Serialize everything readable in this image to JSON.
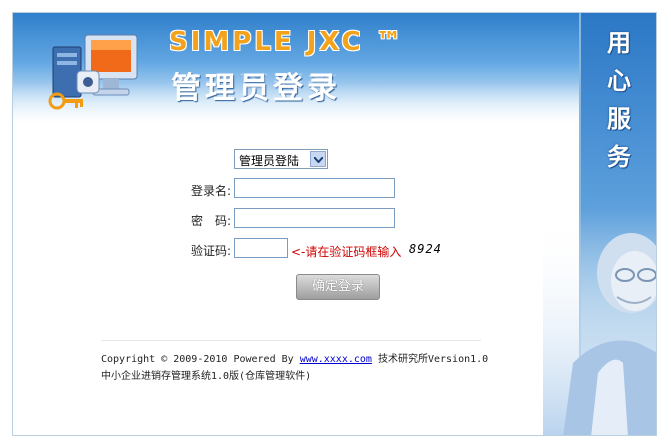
{
  "header": {
    "brand_title": "SIMPLE JXC ™",
    "brand_subtitle": "管理员登录",
    "slogan": [
      "用",
      "心",
      "服",
      "务"
    ]
  },
  "form": {
    "role_select": {
      "value": "管理员登陆"
    },
    "username_label": "登录名:",
    "password_label": "密　码:",
    "captcha_label": "验证码:",
    "username_value": "",
    "password_value": "",
    "captcha_value": "",
    "captcha_hint": "<-请在验证码框输入",
    "captcha_code": "8924",
    "login_button": "确定登录"
  },
  "footer": {
    "copyright_prefix": "Copyright © 2009-2010 Powered By",
    "link": "www.xxxx.com",
    "copyright_suffix": "技术研究所Version1.0",
    "product": "中小企业进销存管理系统1.0版(仓库管理软件)"
  },
  "colors": {
    "header_blue": "#2f7fca",
    "brand_orange": "#f3a21c",
    "hint_red": "#d00000"
  }
}
